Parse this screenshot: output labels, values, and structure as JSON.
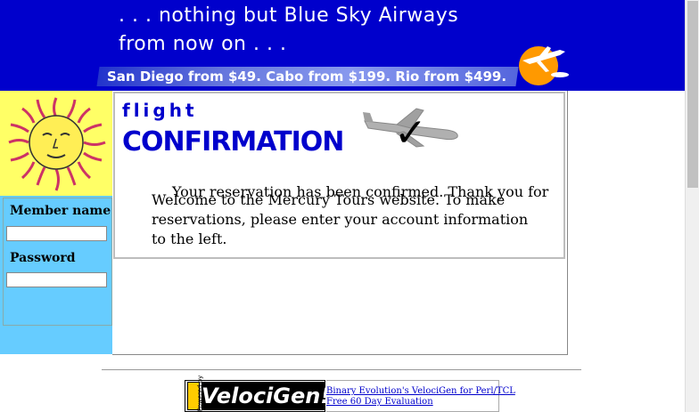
{
  "header": {
    "tagline_line1": ". . . nothing but Blue Sky Airways",
    "tagline_line2": "from now on . . .",
    "prices": "San Diego from $49. Cabo from $199. Rio from $499."
  },
  "sidebar": {
    "member_label": "Member name",
    "password_label": "Password",
    "member_value": "",
    "password_value": ""
  },
  "main": {
    "title_small": "flight",
    "title_large": "CONFIRMATION",
    "confirmed_text": "Your reservation has been confirmed. Thank you for",
    "welcome_text": "Welcome to the Mercury Tours website. To make reservations, please enter your account information to the left."
  },
  "footer": {
    "badge_text": "VelociGen!",
    "powered_text": "Powered by",
    "link1": "Binary Evolution's VelociGen for Perl/TCL",
    "link2": "Free 60 Day Evaluation"
  },
  "colors": {
    "header_bg": "#0000cc",
    "sidebar_bg": "#66ccff",
    "title_color": "#0000cc"
  }
}
